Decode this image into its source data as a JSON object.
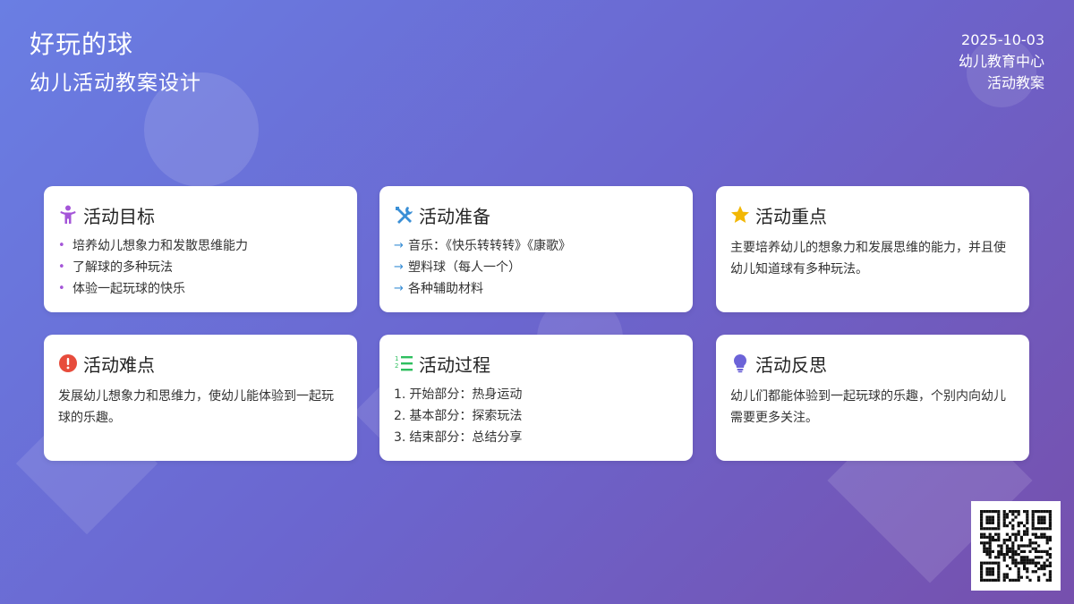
{
  "header": {
    "title": "好玩的球",
    "subtitle": "幼儿活动教案设计",
    "date": "2025-10-03",
    "organization": "幼儿教育中心",
    "doc_type": "活动教案"
  },
  "cards": {
    "goals": {
      "title": "活动目标",
      "icon": "child-icon",
      "icon_color": "#a455d8",
      "items": [
        "培养幼儿想象力和发散思维能力",
        "了解球的多种玩法",
        "体验一起玩球的快乐"
      ]
    },
    "preparation": {
      "title": "活动准备",
      "icon": "tools-icon",
      "icon_color": "#3a8fd6",
      "items": [
        "音乐：《快乐转转转》《康歌》",
        "塑料球（每人一个）",
        "各种辅助材料"
      ]
    },
    "key_points": {
      "title": "活动重点",
      "icon": "star-icon",
      "icon_color": "#f2b705",
      "text": "主要培养幼儿的想象力和发展思维的能力，并且使幼儿知道球有多种玩法。"
    },
    "difficulties": {
      "title": "活动难点",
      "icon": "exclamation-icon",
      "icon_color": "#e74c3c",
      "text": "发展幼儿想象力和思维力，使幼儿能体验到一起玩球的乐趣。"
    },
    "process": {
      "title": "活动过程",
      "icon": "numbered-list-icon",
      "icon_color": "#2ebf5f",
      "items": [
        {
          "num": "1.",
          "text": "开始部分：热身运动"
        },
        {
          "num": "2.",
          "text": "基本部分：探索玩法"
        },
        {
          "num": "3.",
          "text": "结束部分：总结分享"
        }
      ]
    },
    "reflection": {
      "title": "活动反思",
      "icon": "lightbulb-icon",
      "icon_color": "#6c63d8",
      "text": "幼儿们都能体验到一起玩球的乐趣，个别内向幼儿需要更多关注。"
    }
  },
  "qr_code": {
    "icon": "qr-code-icon"
  }
}
